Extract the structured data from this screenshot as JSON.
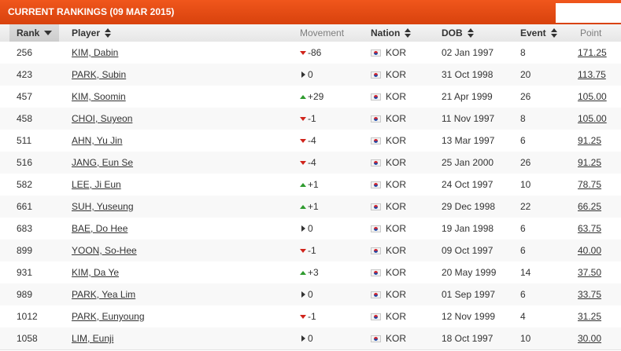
{
  "banner": {
    "title": "CURRENT RANKINGS (09 MAR 2015)"
  },
  "columns": {
    "rank": "Rank",
    "player": "Player",
    "movement": "Movement",
    "nation": "Nation",
    "dob": "DOB",
    "event": "Event",
    "point": "Point"
  },
  "colors": {
    "banner": "#e04a12",
    "down": "#d0241b",
    "up": "#2f9b2f"
  },
  "rows": [
    {
      "rank": "256",
      "player": "KIM, Dabin",
      "move_dir": "down",
      "move": "-86",
      "nation": "KOR",
      "dob": "02 Jan 1997",
      "event": "8",
      "point": "171.25"
    },
    {
      "rank": "423",
      "player": "PARK, Subin",
      "move_dir": "same",
      "move": "0",
      "nation": "KOR",
      "dob": "31 Oct 1998",
      "event": "20",
      "point": "113.75"
    },
    {
      "rank": "457",
      "player": "KIM, Soomin",
      "move_dir": "up",
      "move": "+29",
      "nation": "KOR",
      "dob": "21 Apr 1999",
      "event": "26",
      "point": "105.00"
    },
    {
      "rank": "458",
      "player": "CHOI, Suyeon",
      "move_dir": "down",
      "move": "-1",
      "nation": "KOR",
      "dob": "11 Nov 1997",
      "event": "8",
      "point": "105.00"
    },
    {
      "rank": "511",
      "player": "AHN, Yu Jin",
      "move_dir": "down",
      "move": "-4",
      "nation": "KOR",
      "dob": "13 Mar 1997",
      "event": "6",
      "point": "91.25"
    },
    {
      "rank": "516",
      "player": "JANG, Eun Se",
      "move_dir": "down",
      "move": "-4",
      "nation": "KOR",
      "dob": "25 Jan 2000",
      "event": "26",
      "point": "91.25"
    },
    {
      "rank": "582",
      "player": "LEE, Ji Eun",
      "move_dir": "up",
      "move": "+1",
      "nation": "KOR",
      "dob": "24 Oct 1997",
      "event": "10",
      "point": "78.75"
    },
    {
      "rank": "661",
      "player": "SUH, Yuseung",
      "move_dir": "up",
      "move": "+1",
      "nation": "KOR",
      "dob": "29 Dec 1998",
      "event": "22",
      "point": "66.25"
    },
    {
      "rank": "683",
      "player": "BAE, Do Hee",
      "move_dir": "same",
      "move": "0",
      "nation": "KOR",
      "dob": "19 Jan 1998",
      "event": "6",
      "point": "63.75"
    },
    {
      "rank": "899",
      "player": "YOON, So-Hee",
      "move_dir": "down",
      "move": "-1",
      "nation": "KOR",
      "dob": "09 Oct 1997",
      "event": "6",
      "point": "40.00"
    },
    {
      "rank": "931",
      "player": "KIM, Da Ye",
      "move_dir": "up",
      "move": "+3",
      "nation": "KOR",
      "dob": "20 May 1999",
      "event": "14",
      "point": "37.50"
    },
    {
      "rank": "989",
      "player": "PARK, Yea Lim",
      "move_dir": "same",
      "move": "0",
      "nation": "KOR",
      "dob": "01 Sep 1997",
      "event": "6",
      "point": "33.75"
    },
    {
      "rank": "1012",
      "player": "PARK, Eunyoung",
      "move_dir": "down",
      "move": "-1",
      "nation": "KOR",
      "dob": "12 Nov 1999",
      "event": "4",
      "point": "31.25"
    },
    {
      "rank": "1058",
      "player": "LIM, Eunji",
      "move_dir": "same",
      "move": "0",
      "nation": "KOR",
      "dob": "18 Oct 1997",
      "event": "10",
      "point": "30.00"
    }
  ]
}
